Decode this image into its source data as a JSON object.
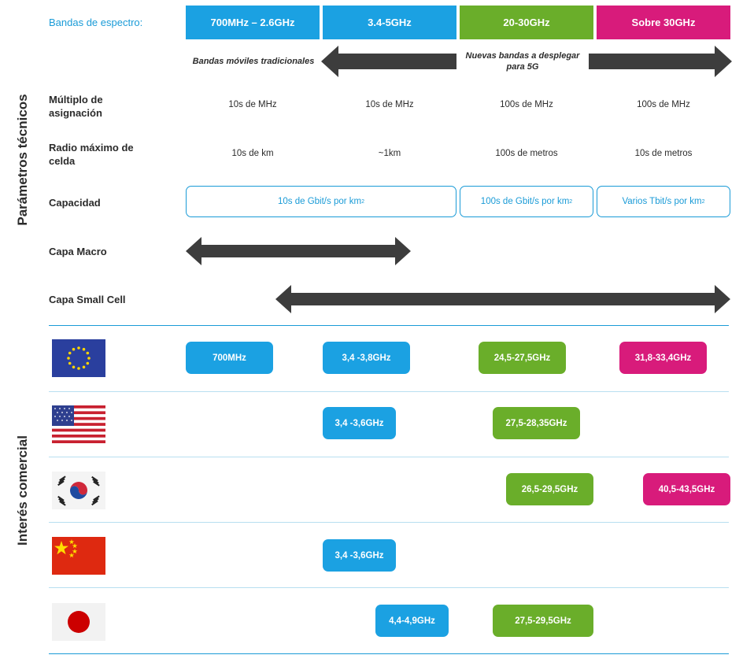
{
  "header": {
    "label": "Bandas de espectro:",
    "bands": [
      {
        "label": "700MHz – 2.6GHz",
        "color": "#1ba1e2"
      },
      {
        "label": "3.4-5GHz",
        "color": "#1ba1e2"
      },
      {
        "label": "20-30GHz",
        "color": "#6aae2a"
      },
      {
        "label": "Sobre 30GHz",
        "color": "#d81b7b"
      }
    ]
  },
  "arrow_notes": {
    "left": "Bandas móviles tradicionales",
    "right_line1": "Nuevas bandas a desplegar",
    "right_line2": "para 5G"
  },
  "technical": {
    "section_title": "Parámetros técnicos",
    "multiplo": {
      "label_line1": "Múltiplo de",
      "label_line2": "asignación",
      "values": [
        "10s de MHz",
        "10s de MHz",
        "100s de MHz",
        "100s de MHz"
      ]
    },
    "radio": {
      "label_line1": "Radio máximo de",
      "label_line2": "celda",
      "values": [
        "10s de km",
        "~1km",
        "100s de metros",
        "10s de metros"
      ]
    },
    "capacidad": {
      "label": "Capacidad",
      "boxes": [
        {
          "text": "10s de Gbit/s por km",
          "sup": "2"
        },
        {
          "text": "100s de Gbit/s por km",
          "sup": "2"
        },
        {
          "text": "Varios Tbit/s por km",
          "sup": "2"
        }
      ]
    },
    "capa_macro": "Capa Macro",
    "capa_small": "Capa Small Cell"
  },
  "commercial": {
    "section_title": "Interés comercial",
    "regions": [
      {
        "flag_icon": "eu-flag-icon",
        "pills": [
          "700MHz",
          "3,4 -3,8GHz",
          "24,5-27,5GHz",
          "31,8-33,4GHz"
        ]
      },
      {
        "flag_icon": "usa-flag-icon",
        "pills": [
          "3,4 -3,6GHz",
          "27,5-28,35GHz"
        ]
      },
      {
        "flag_icon": "korea-flag-icon",
        "pills": [
          "26,5-29,5GHz",
          "40,5-43,5GHz"
        ]
      },
      {
        "flag_icon": "china-flag-icon",
        "pills": [
          "3,4 -3,6GHz"
        ]
      },
      {
        "flag_icon": "japan-flag-icon",
        "pills": [
          "4,4-4,9GHz",
          "27,5-29,5GHz"
        ]
      }
    ]
  },
  "colors": {
    "blue": "#1ba1e2",
    "green": "#6aae2a",
    "pink": "#d81b7b",
    "divider": "#1a9bd7",
    "arrow": "#3d3d3d"
  }
}
